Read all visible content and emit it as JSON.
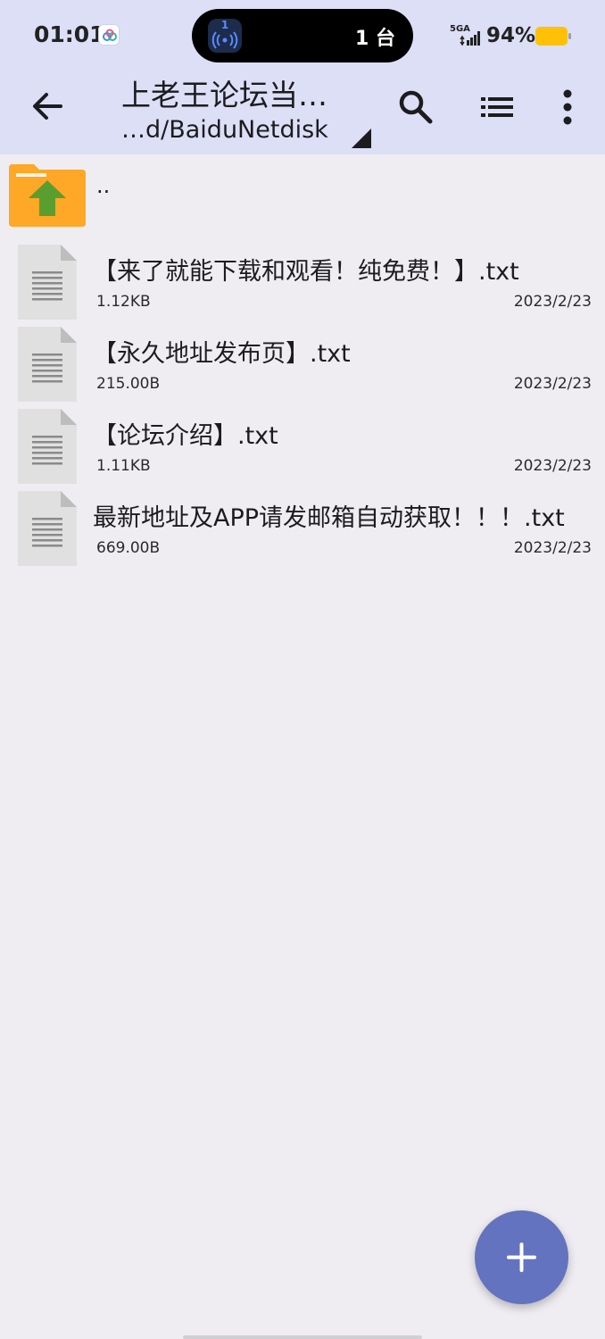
{
  "status_bar": {
    "time": "01:01",
    "pill_badge": "1",
    "pill_count": "1 台",
    "network": "5GA",
    "battery": "94%"
  },
  "toolbar": {
    "title": "上老王论坛当…",
    "path": "…d/BaiduNetdisk"
  },
  "parent_dir": {
    "label": ".."
  },
  "files": [
    {
      "name": "【来了就能下载和观看！纯免费！】.txt",
      "size": "1.12KB",
      "date": "2023/2/23"
    },
    {
      "name": "【永久地址发布页】.txt",
      "size": "215.00B",
      "date": "2023/2/23"
    },
    {
      "name": "【论坛介绍】.txt",
      "size": "1.11KB",
      "date": "2023/2/23"
    },
    {
      "name": "最新地址及APP请发邮箱自动获取！！！.txt",
      "size": "669.00B",
      "date": "2023/2/23"
    }
  ],
  "colors": {
    "header_bg": "#dcdff6",
    "body_bg": "#efedf2",
    "fab": "#6473bf",
    "folder": "#ffa726",
    "arrow": "#5a9e2f",
    "battery": "#ffc107"
  }
}
